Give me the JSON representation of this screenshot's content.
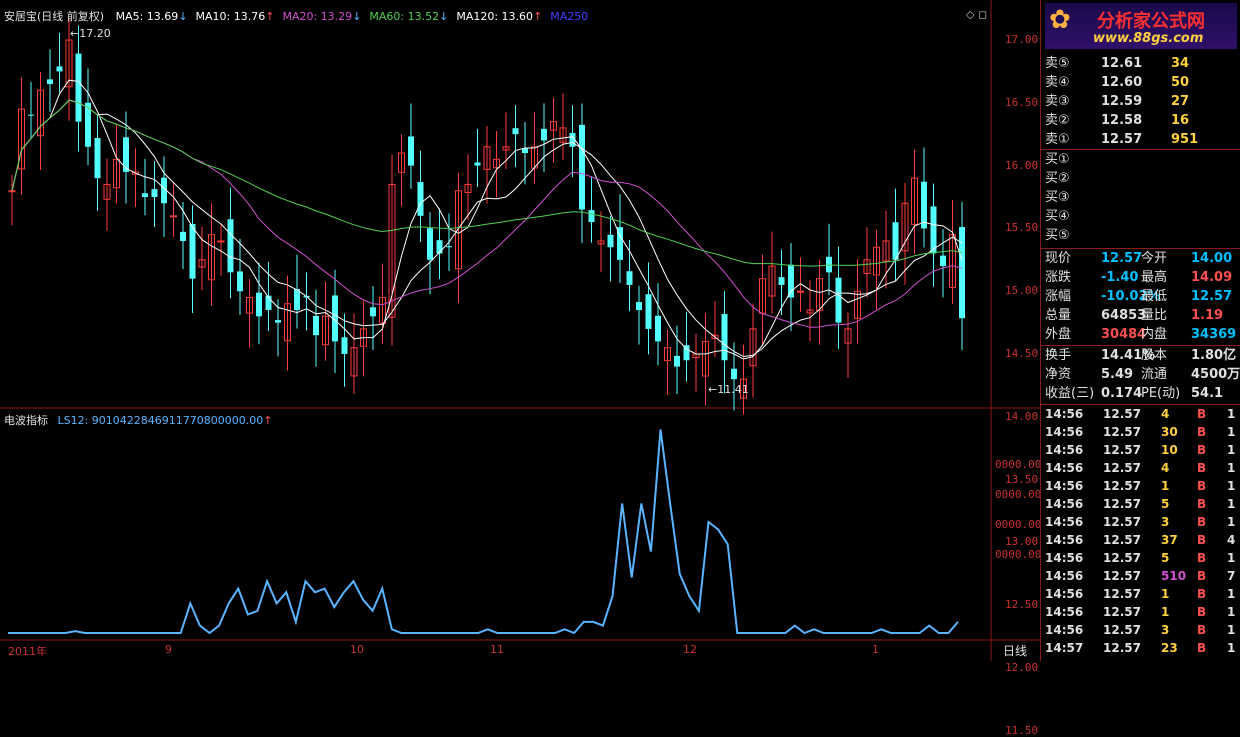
{
  "header": {
    "title": "安居宝(日线 前复权)",
    "ma": [
      {
        "label": "MA5: 13.69",
        "arrow": "↓",
        "color": "#ffffff"
      },
      {
        "label": "MA10: 13.76",
        "arrow": "↑",
        "color": "#ffffff"
      },
      {
        "label": "MA20: 13.29",
        "arrow": "↓",
        "color": "#d050d0"
      },
      {
        "label": "MA60: 13.52",
        "arrow": "↓",
        "color": "#50d050"
      },
      {
        "label": "MA120: 13.60",
        "arrow": "↑",
        "color": "#ffffff"
      },
      {
        "label": "MA250",
        "arrow": "",
        "color": "#4040ff"
      }
    ],
    "high_marker": "17.20",
    "low_marker": "11.41"
  },
  "indicator": {
    "name": "电波指标",
    "label": "LS12: 9010422846911770800000.00",
    "arrow": "↑",
    "axis_labels": [
      "0000.00",
      "0000.00",
      "0000.00",
      "0000.00"
    ]
  },
  "price_axis": [
    "17.00",
    "16.50",
    "16.00",
    "15.50",
    "15.00",
    "14.50",
    "14.00",
    "13.50",
    "13.00",
    "12.50",
    "12.00",
    "11.50"
  ],
  "date_axis": [
    "2011年",
    "9",
    "10",
    "11",
    "12",
    "1"
  ],
  "period_label": "日线",
  "logo": {
    "text": "分析家公式网",
    "url": "www.88gs.com"
  },
  "asks": [
    {
      "label": "卖⑤",
      "price": "12.61",
      "vol": "34"
    },
    {
      "label": "卖④",
      "price": "12.60",
      "vol": "50"
    },
    {
      "label": "卖③",
      "price": "12.59",
      "vol": "27"
    },
    {
      "label": "卖②",
      "price": "12.58",
      "vol": "16"
    },
    {
      "label": "卖①",
      "price": "12.57",
      "vol": "951"
    }
  ],
  "bids": [
    {
      "label": "买①"
    },
    {
      "label": "买②"
    },
    {
      "label": "买③"
    },
    {
      "label": "买④"
    },
    {
      "label": "买⑤"
    }
  ],
  "stats": [
    {
      "l1": "现价",
      "v1": "12.57",
      "l2": "今开",
      "v2": "14.00",
      "c1": "#00c0ff",
      "c2": "#00c0ff"
    },
    {
      "l1": "涨跌",
      "v1": "-1.40",
      "l2": "最高",
      "v2": "14.09",
      "c1": "#00c0ff",
      "c2": "#ff5050"
    },
    {
      "l1": "涨幅",
      "v1": "-10.02%",
      "l2": "最低",
      "v2": "12.57",
      "c1": "#00c0ff",
      "c2": "#00c0ff"
    },
    {
      "l1": "总量",
      "v1": "64853",
      "l2": "量比",
      "v2": "1.19",
      "c1": "#e0e0e0",
      "c2": "#ff5050"
    },
    {
      "l1": "外盘",
      "v1": "30484",
      "l2": "内盘",
      "v2": "34369",
      "c1": "#ff5050",
      "c2": "#00c0ff"
    }
  ],
  "stats2": [
    {
      "l1": "换手",
      "v1": "14.41%",
      "l2": "股本",
      "v2": "1.80亿"
    },
    {
      "l1": "净资",
      "v1": "5.49",
      "l2": "流通",
      "v2": "4500万"
    },
    {
      "l1": "收益(三)",
      "v1": "0.174",
      "l2": "PE(动)",
      "v2": "54.1"
    }
  ],
  "ticks": [
    {
      "t": "14:56",
      "p": "12.57",
      "v": "4",
      "s": "B",
      "n": "1"
    },
    {
      "t": "14:56",
      "p": "12.57",
      "v": "30",
      "s": "B",
      "n": "1"
    },
    {
      "t": "14:56",
      "p": "12.57",
      "v": "10",
      "s": "B",
      "n": "1"
    },
    {
      "t": "14:56",
      "p": "12.57",
      "v": "4",
      "s": "B",
      "n": "1"
    },
    {
      "t": "14:56",
      "p": "12.57",
      "v": "1",
      "s": "B",
      "n": "1"
    },
    {
      "t": "14:56",
      "p": "12.57",
      "v": "5",
      "s": "B",
      "n": "1"
    },
    {
      "t": "14:56",
      "p": "12.57",
      "v": "3",
      "s": "B",
      "n": "1"
    },
    {
      "t": "14:56",
      "p": "12.57",
      "v": "37",
      "s": "B",
      "n": "4"
    },
    {
      "t": "14:56",
      "p": "12.57",
      "v": "5",
      "s": "B",
      "n": "1"
    },
    {
      "t": "14:56",
      "p": "12.57",
      "v": "510",
      "s": "B",
      "n": "7"
    },
    {
      "t": "14:56",
      "p": "12.57",
      "v": "1",
      "s": "B",
      "n": "1"
    },
    {
      "t": "14:56",
      "p": "12.57",
      "v": "1",
      "s": "B",
      "n": "1"
    },
    {
      "t": "14:56",
      "p": "12.57",
      "v": "3",
      "s": "B",
      "n": "1"
    },
    {
      "t": "14:57",
      "p": "12.57",
      "v": "23",
      "s": "B",
      "n": "1"
    }
  ],
  "colors": {
    "up": "#ff3c3c",
    "down": "#54ffff",
    "grid": "#8b1a1a",
    "wave": "#5ab4ff"
  }
}
